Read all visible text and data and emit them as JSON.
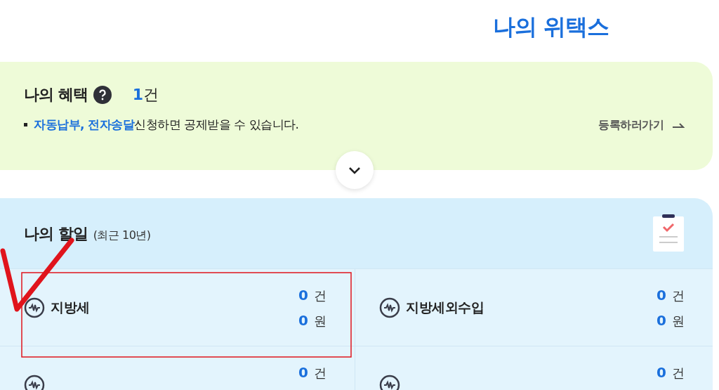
{
  "page_title": "나의 위택스",
  "benefits": {
    "title": "나의 혜택",
    "count": "1",
    "count_unit": "건",
    "notice_highlight": "자동납부, 전자송달",
    "notice_rest": "신청하면 공제받을 수 있습니다.",
    "link": "등록하러가기"
  },
  "tasks": {
    "title": "나의 할일",
    "subtitle": "(최근 10년)",
    "items": [
      {
        "name": "지방세",
        "count": "0",
        "count_unit": "건",
        "amount": "0",
        "amount_unit": "원"
      },
      {
        "name": "지방세외수입",
        "count": "0",
        "count_unit": "건",
        "amount": "0",
        "amount_unit": "원"
      },
      {
        "count": "0",
        "count_unit": "건"
      },
      {
        "count": "0",
        "count_unit": "건"
      }
    ]
  },
  "annotations": {
    "check_mark": true,
    "highlight_box": true
  }
}
